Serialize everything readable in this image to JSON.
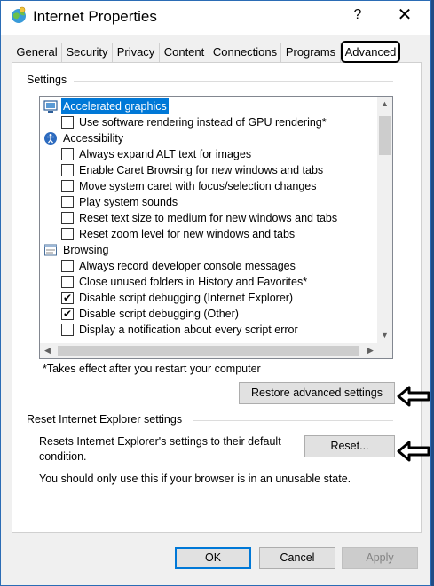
{
  "window": {
    "title": "Internet Properties",
    "help_glyph": "?",
    "close_glyph": "✕"
  },
  "tabs": [
    {
      "label": "General"
    },
    {
      "label": "Security"
    },
    {
      "label": "Privacy"
    },
    {
      "label": "Content"
    },
    {
      "label": "Connections"
    },
    {
      "label": "Programs"
    },
    {
      "label": "Advanced",
      "active": true
    }
  ],
  "settings": {
    "group_label": "Settings",
    "items": [
      {
        "kind": "category",
        "label": "Accelerated graphics",
        "icon": "monitor-icon",
        "selected": true
      },
      {
        "kind": "check",
        "label": "Use software rendering instead of GPU rendering*",
        "checked": false
      },
      {
        "kind": "category",
        "label": "Accessibility",
        "icon": "accessibility-icon"
      },
      {
        "kind": "check",
        "label": "Always expand ALT text for images",
        "checked": false
      },
      {
        "kind": "check",
        "label": "Enable Caret Browsing for new windows and tabs",
        "checked": false
      },
      {
        "kind": "check",
        "label": "Move system caret with focus/selection changes",
        "checked": false
      },
      {
        "kind": "check",
        "label": "Play system sounds",
        "checked": false
      },
      {
        "kind": "check",
        "label": "Reset text size to medium for new windows and tabs",
        "checked": false
      },
      {
        "kind": "check",
        "label": "Reset zoom level for new windows and tabs",
        "checked": false
      },
      {
        "kind": "category",
        "label": "Browsing",
        "icon": "browsing-icon"
      },
      {
        "kind": "check",
        "label": "Always record developer console messages",
        "checked": false
      },
      {
        "kind": "check",
        "label": "Close unused folders in History and Favorites*",
        "checked": false
      },
      {
        "kind": "check",
        "label": "Disable script debugging (Internet Explorer)",
        "checked": true
      },
      {
        "kind": "check",
        "label": "Disable script debugging (Other)",
        "checked": true
      },
      {
        "kind": "check",
        "label": "Display a notification about every script error",
        "checked": false
      }
    ],
    "footnote": "*Takes effect after you restart your computer",
    "restore_label": "Restore advanced settings"
  },
  "reset_section": {
    "group_label": "Reset Internet Explorer settings",
    "description": "Resets Internet Explorer's settings to their default condition.",
    "reset_label": "Reset...",
    "warning": "You should only use this if your browser is in an unusable state."
  },
  "footer": {
    "ok_label": "OK",
    "cancel_label": "Cancel",
    "apply_label": "Apply"
  },
  "colors": {
    "selection": "#0078d7",
    "window_border": "#2b6cb5"
  }
}
